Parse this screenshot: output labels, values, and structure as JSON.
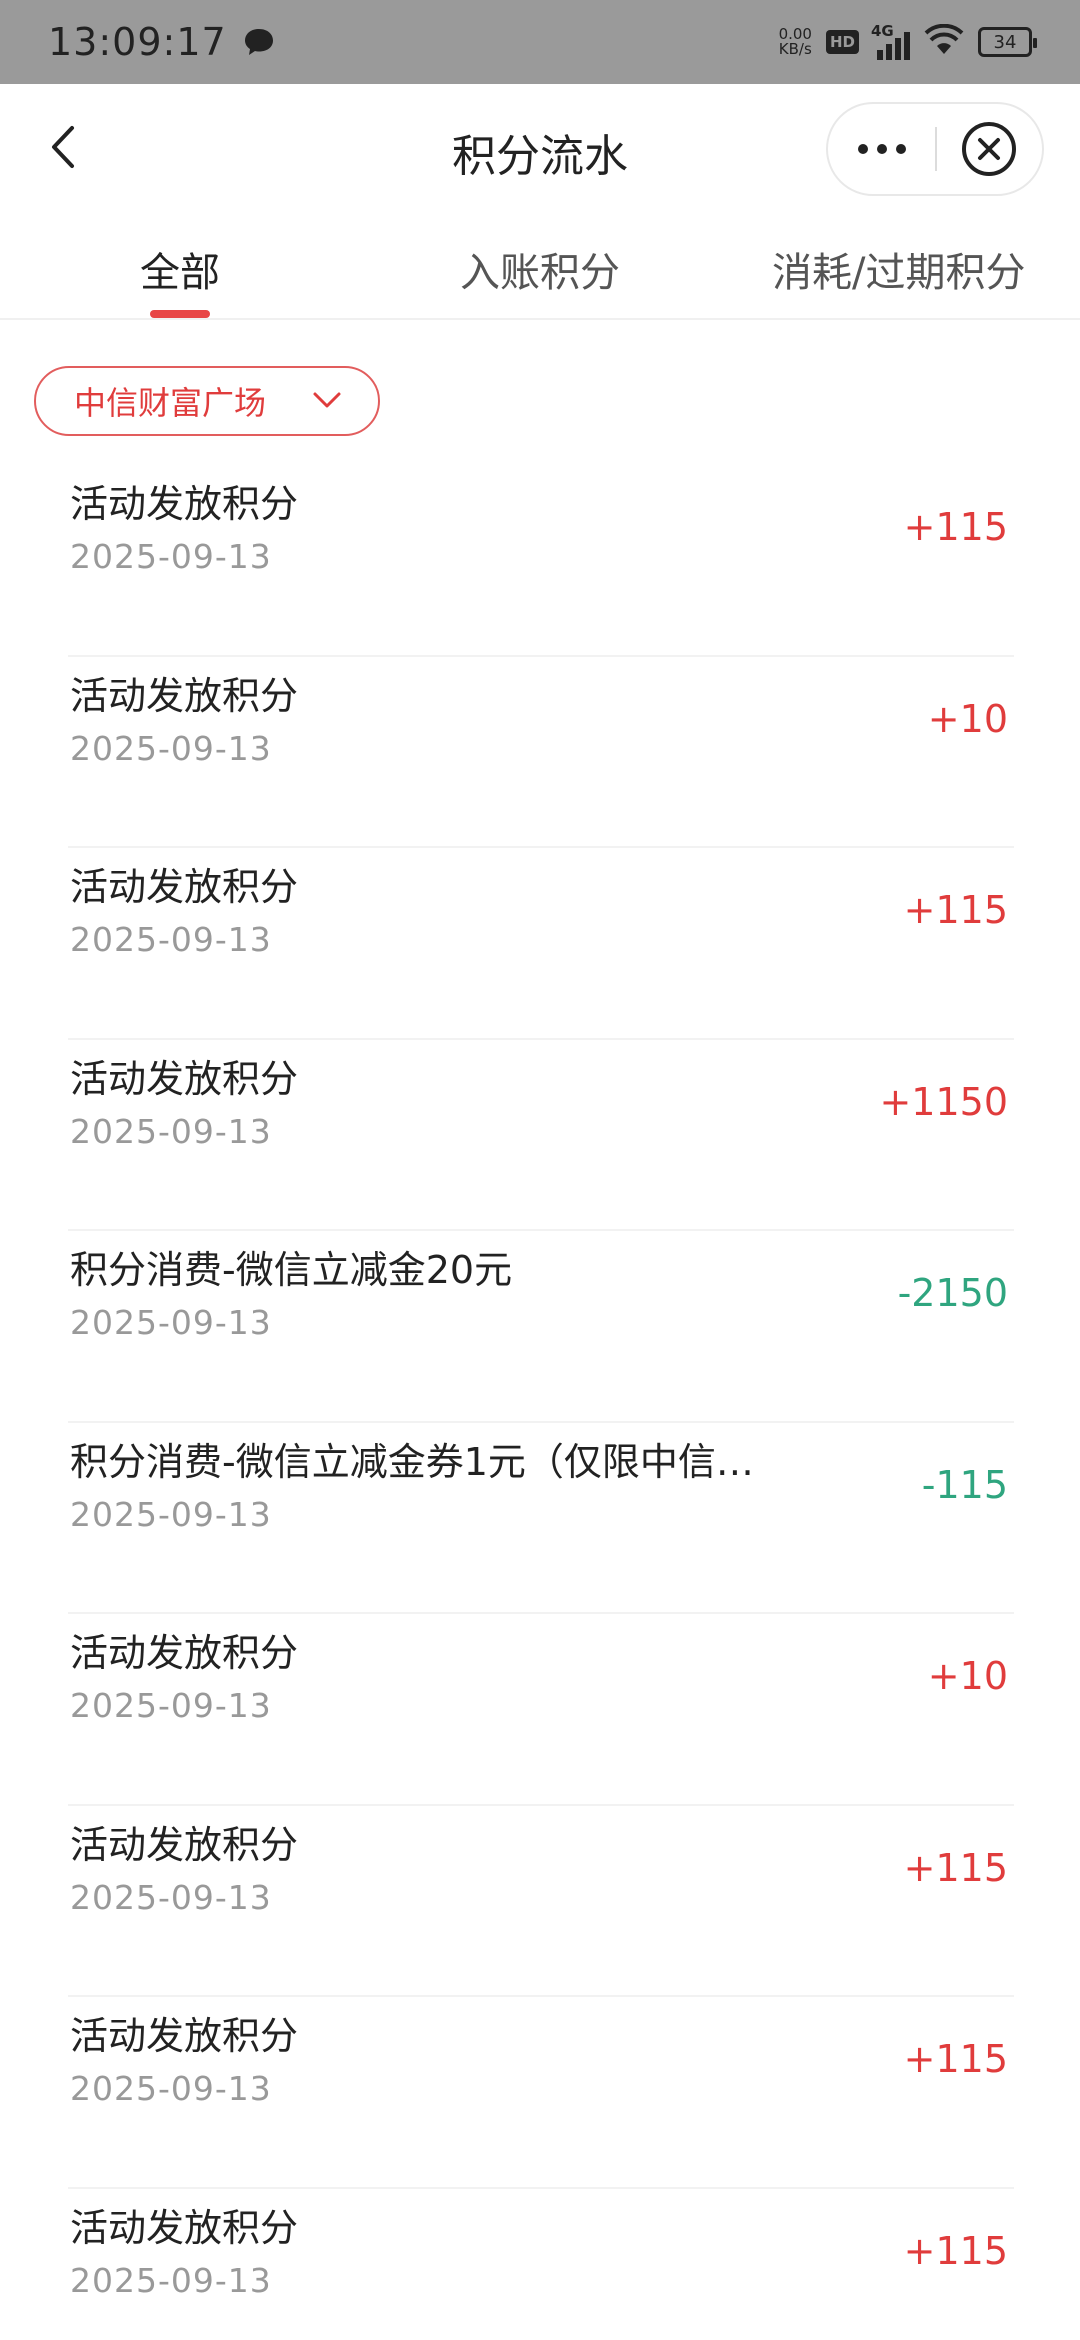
{
  "status_bar": {
    "time": "13:09:17",
    "net_speed_value": "0.00",
    "net_speed_unit": "KB/s",
    "hd": "HD",
    "network": "4G",
    "battery": "34"
  },
  "nav": {
    "title": "积分流水"
  },
  "tabs": [
    {
      "label": "全部",
      "active": true
    },
    {
      "label": "入账积分",
      "active": false
    },
    {
      "label": "消耗/过期积分",
      "active": false
    }
  ],
  "filter": {
    "label": "中信财富广场"
  },
  "records": [
    {
      "title": "活动发放积分",
      "date": "2025-09-13",
      "amount": "+115",
      "type": "income"
    },
    {
      "title": "活动发放积分",
      "date": "2025-09-13",
      "amount": "+10",
      "type": "income"
    },
    {
      "title": "活动发放积分",
      "date": "2025-09-13",
      "amount": "+115",
      "type": "income"
    },
    {
      "title": "活动发放积分",
      "date": "2025-09-13",
      "amount": "+1150",
      "type": "income"
    },
    {
      "title": "积分消费-微信立减金20元",
      "date": "2025-09-13",
      "amount": "-2150",
      "type": "expense"
    },
    {
      "title": "积分消费-微信立减金券1元（仅限中信…",
      "date": "2025-09-13",
      "amount": "-115",
      "type": "expense"
    },
    {
      "title": "活动发放积分",
      "date": "2025-09-13",
      "amount": "+10",
      "type": "income"
    },
    {
      "title": "活动发放积分",
      "date": "2025-09-13",
      "amount": "+115",
      "type": "income"
    },
    {
      "title": "活动发放积分",
      "date": "2025-09-13",
      "amount": "+115",
      "type": "income"
    },
    {
      "title": "活动发放积分",
      "date": "2025-09-13",
      "amount": "+115",
      "type": "income"
    }
  ],
  "colors": {
    "accent": "#e03c3c",
    "income": "#e03c3c",
    "expense": "#2fa57f",
    "tab_indicator": "#e84545"
  }
}
